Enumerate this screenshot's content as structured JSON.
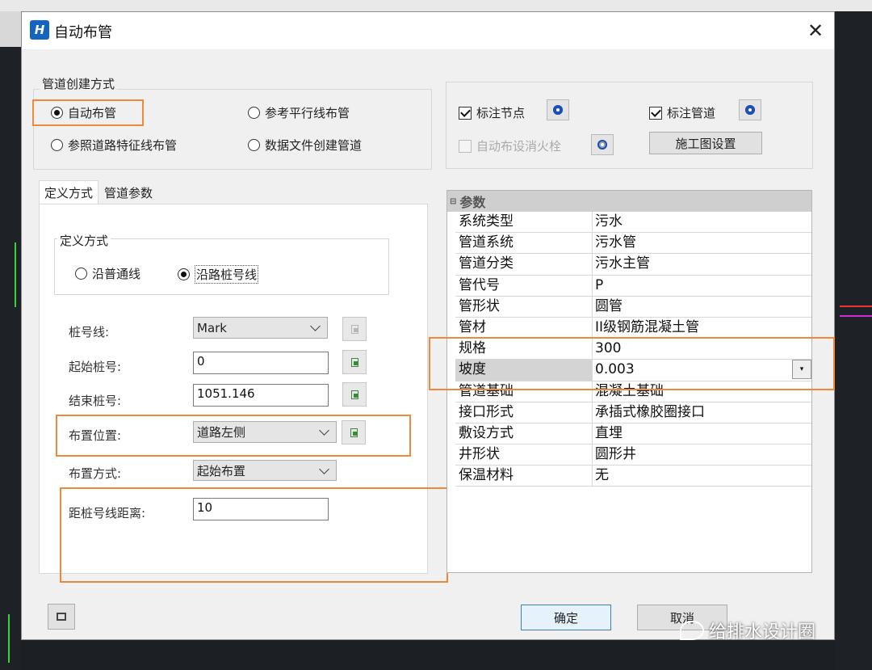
{
  "window": {
    "title": "自动布管",
    "close_glyph": "✕"
  },
  "creation": {
    "group_label": "管道创建方式",
    "options": [
      {
        "label": "自动布管",
        "selected": true
      },
      {
        "label": "参考平行线布管",
        "selected": false
      },
      {
        "label": "参照道路特征线布管",
        "selected": false
      },
      {
        "label": "数据文件创建管道",
        "selected": false
      }
    ]
  },
  "annotate": {
    "node": {
      "label": "标注节点",
      "checked": true
    },
    "pipe": {
      "label": "标注管道",
      "checked": true
    },
    "hydrant": {
      "label": "自动布设消火栓",
      "checked": false,
      "disabled": true
    },
    "drawing_button": "施工图设置"
  },
  "tabs": [
    {
      "label": "定义方式",
      "active": true
    },
    {
      "label": "管道参数",
      "active": false
    }
  ],
  "define": {
    "group_label": "定义方式",
    "options": [
      {
        "label": "沿普通线",
        "selected": false
      },
      {
        "label": "沿路桩号线",
        "selected": true
      }
    ]
  },
  "form": {
    "station_line": {
      "label": "桩号线:",
      "value": "Mark"
    },
    "start_station": {
      "label": "起始桩号:",
      "value": "0"
    },
    "end_station": {
      "label": "结束桩号:",
      "value": "1051.146"
    },
    "position": {
      "label": "布置位置:",
      "value": "道路左侧"
    },
    "method": {
      "label": "布置方式:",
      "value": "起始布置"
    },
    "offset": {
      "label": "距桩号线距离:",
      "value": "10"
    }
  },
  "params": {
    "header": "参数",
    "rows": [
      {
        "key": "系统类型",
        "value": "污水"
      },
      {
        "key": "管道系统",
        "value": "污水管"
      },
      {
        "key": "管道分类",
        "value": "污水主管"
      },
      {
        "key": "管代号",
        "value": "P"
      },
      {
        "key": "管形状",
        "value": "圆管"
      },
      {
        "key": "管材",
        "value": "II级钢筋混凝土管"
      },
      {
        "key": "规格",
        "value": "300"
      },
      {
        "key": "坡度",
        "value": "0.003"
      },
      {
        "key": "管道基础",
        "value": "混凝土基础"
      },
      {
        "key": "接口形式",
        "value": "承插式橡胶圈接口"
      },
      {
        "key": "敷设方式",
        "value": "直埋"
      },
      {
        "key": "井形状",
        "value": "圆形井"
      },
      {
        "key": "保温材料",
        "value": "无"
      }
    ]
  },
  "footer": {
    "ok": "确定",
    "cancel": "取消"
  },
  "watermark": "给排水设计圈",
  "colors": {
    "highlight": "#f0883a",
    "accent": "#3c7fb1"
  }
}
